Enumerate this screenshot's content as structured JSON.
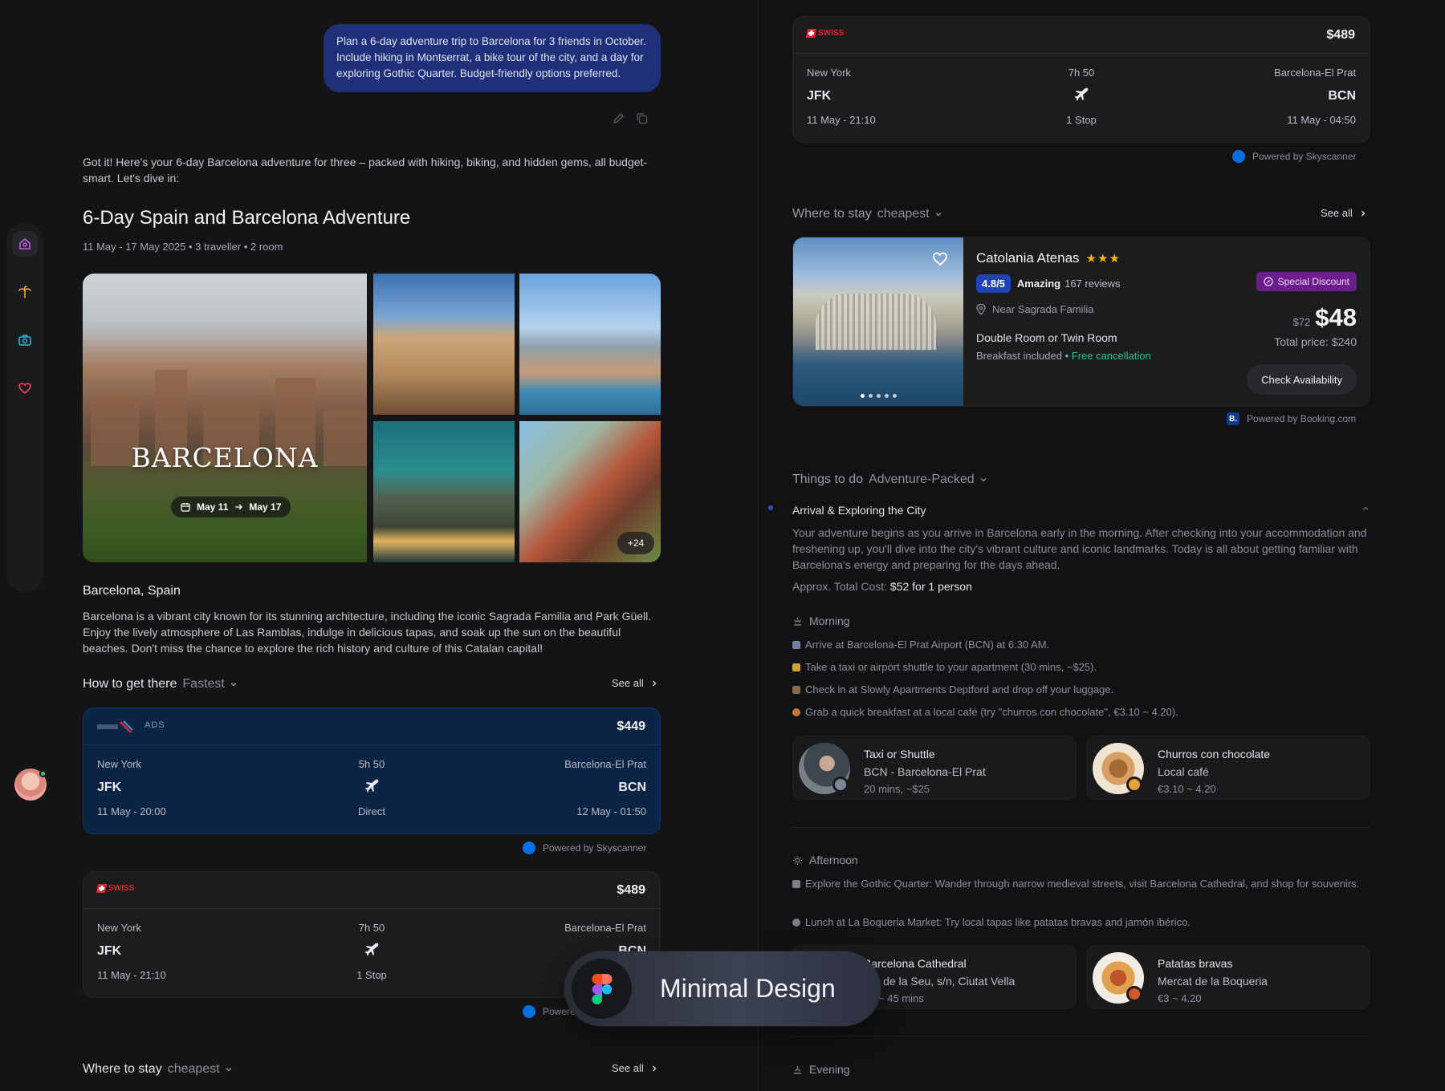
{
  "chat": {
    "user_message": "Plan a 6-day adventure trip to Barcelona for 3 friends in October. Include hiking in Montserrat, a bike tour of the city, and a day for exploring Gothic Quarter. Budget-friendly options preferred.",
    "reply_intro": "Got it! Here's your 6-day Barcelona adventure for three – packed with hiking, biking, and hidden gems, all budget-smart. Let's dive in:"
  },
  "trip": {
    "title": "6-Day Spain and Barcelona Adventure",
    "subtitle": "11 May - 17 May 2025 • 3 traveller • 2 room",
    "city_label": "BARCELONA",
    "date_from": "May 11",
    "date_to": "May 17",
    "more_photos": "+24",
    "place": "Barcelona, Spain",
    "place_description": "Barcelona is a vibrant city known for its stunning architecture, including the iconic Sagrada Familia and Park Güell. Enjoy the lively atmosphere of Las Ramblas, indulge in delicious tapas, and soak up the sun on the beautiful beaches. Don't miss the chance to explore the rich history and culture of this Catalan capital!"
  },
  "transport": {
    "heading": "How to get there",
    "modifier": "Fastest",
    "see_all": "See all",
    "flights": [
      {
        "airline": "American Airlines",
        "tag": "ADS",
        "price": "$449",
        "from_city": "New York",
        "from_code": "JFK",
        "depart": "11 May - 20:00",
        "duration": "5h 50",
        "stops": "Direct",
        "to_city": "Barcelona-El Prat",
        "to_code": "BCN",
        "arrive": "12 May - 01:50"
      },
      {
        "airline": "SWISS",
        "tag": "",
        "price": "$489",
        "from_city": "New York",
        "from_code": "JFK",
        "depart": "11 May - 21:10",
        "duration": "7h 50",
        "stops": "1 Stop",
        "to_city": "Barcelona-El Prat",
        "to_code": "BCN",
        "arrive": "11 May - 04:50"
      }
    ],
    "powered_by": "Powered by Skyscanner"
  },
  "stay": {
    "heading": "Where to stay",
    "modifier": "cheapest",
    "see_all": "See all",
    "hotel": {
      "name": "Catolania Atenas",
      "stars": "★★★",
      "rating": "4.8/5",
      "rating_word": "Amazing",
      "reviews": "167 reviews",
      "location": "Near Sagrada Familia",
      "room": "Double Room or Twin Room",
      "breakfast": "Breakfast included",
      "cancellation": "Free cancellation",
      "badge": "Special Discount",
      "old_price": "$72",
      "price": "$48",
      "total": "Total price: $240",
      "cta": "Check Availability"
    },
    "powered_by": "Powered by Booking.com"
  },
  "things": {
    "heading": "Things to do",
    "modifier": "Adventure-Packed",
    "day_title": "Arrival & Exploring the City",
    "day_description": "Your adventure begins as you arrive in Barcelona early in the morning. After checking into your accommodation and freshening up, you'll dive into the city's vibrant culture and iconic landmarks. Today is all about getting familiar with Barcelona's energy and preparing for the days ahead.",
    "cost_prefix": "Approx. Total Cost:",
    "cost_value": "$52",
    "cost_suffix": "for 1 person",
    "morning": {
      "label": "Morning",
      "steps": [
        "Arrive at Barcelona-El Prat Airport (BCN) at 6:30 AM.",
        "Take a taxi or airport shuttle to your apartment (30 mins, ~$25).",
        "Check in at Slowly Apartments Deptford and drop off your luggage.",
        "Grab a quick breakfast at a local café (try \"churros con chocolate\", €3.10 ~ 4.20)."
      ],
      "cards": [
        {
          "title": "Taxi or Shuttle",
          "subtitle": "BCN - Barcelona-El Prat",
          "meta": "20 mins, ~$25"
        },
        {
          "title": "Churros con chocolate",
          "subtitle": "Local café",
          "meta": "€3.10 ~ 4.20"
        }
      ]
    },
    "afternoon": {
      "label": "Afternoon",
      "steps": [
        "Explore the Gothic Quarter: Wander through narrow medieval streets, visit Barcelona Cathedral, and shop for souvenirs.",
        "Lunch at La Boqueria Market: Try local tapas like patatas bravas and jamón ibérico."
      ],
      "cards": [
        {
          "title": "Barcelona Cathedral",
          "subtitle": "Pla de la Seu, s/n, Ciutat Vella",
          "meta": "30 ~ 45 mins"
        },
        {
          "title": "Patatas bravas",
          "subtitle": "Mercat de la Boqueria",
          "meta": "€3 ~ 4.20"
        }
      ]
    },
    "evening": {
      "label": "Evening"
    }
  },
  "badge": {
    "label": "Minimal Design"
  },
  "colors": {
    "accent": "#1f2f78",
    "brand_red": "#e3262b",
    "success": "#27c38b",
    "discount": "#6b1d8c",
    "star": "#f5b400"
  },
  "icons": [
    "home-icon",
    "palm-icon",
    "camera-icon",
    "heart-icon",
    "edit-icon",
    "copy-icon",
    "calendar-icon",
    "plane-icon",
    "chevron-down-icon",
    "chevron-right-icon",
    "location-pin-icon",
    "discount-icon",
    "sun-icon",
    "figma-icon"
  ]
}
